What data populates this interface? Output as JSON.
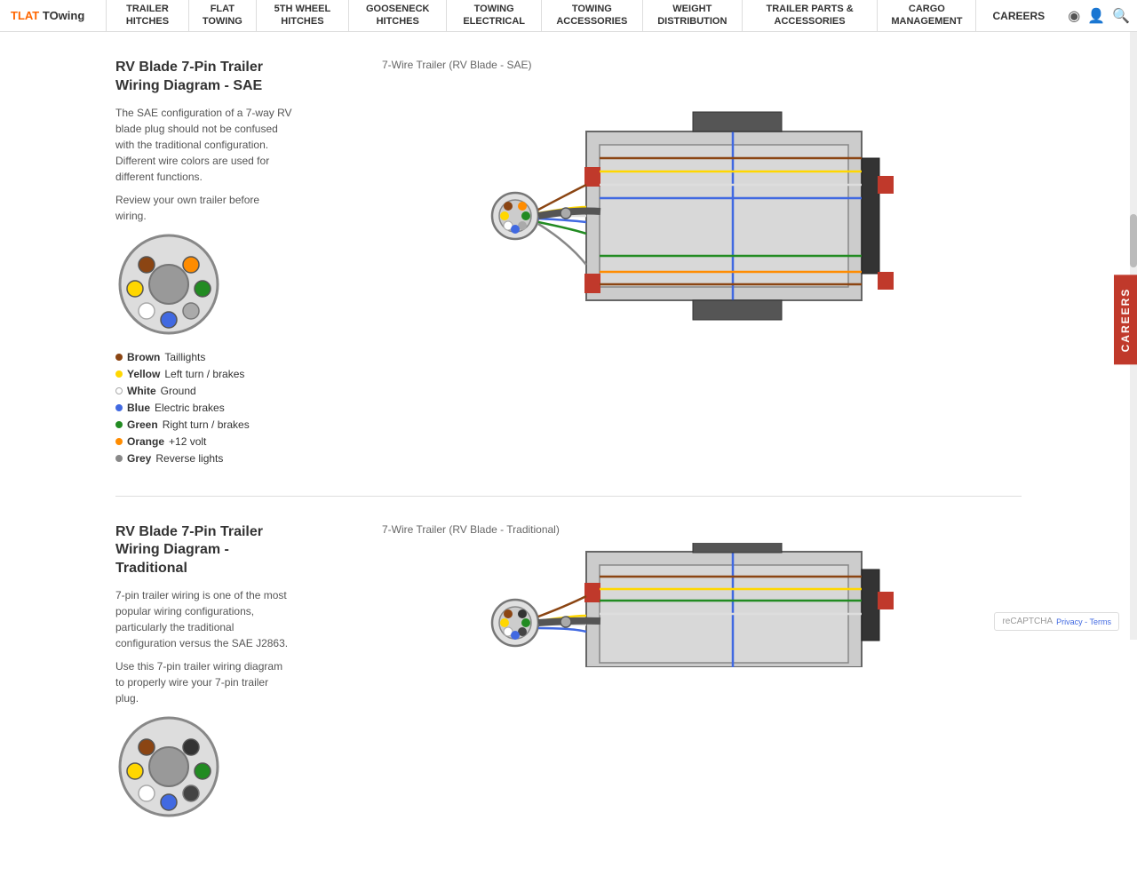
{
  "nav": {
    "logo_line1": "TLAT",
    "logo_line2": "TOwing",
    "items": [
      {
        "label": "TRAILER HITCHES"
      },
      {
        "label": "FLAT TOWING"
      },
      {
        "label": "5TH WHEEL HITCHES"
      },
      {
        "label": "GOOSENECK HITCHES"
      },
      {
        "label": "TOWING ELECTRICAL"
      },
      {
        "label": "TOWING ACCESSORIES"
      },
      {
        "label": "WEIGHT DISTRIBUTION"
      },
      {
        "label": "TRAILER PARTS & ACCESSORIES"
      },
      {
        "label": "CARGO MANAGEMENT"
      }
    ],
    "careers": "CAREERS"
  },
  "careers_tab": "CAREERS",
  "sections": [
    {
      "title": "RV Blade 7-Pin Trailer Wiring Diagram - SAE",
      "desc1": "The SAE configuration of a 7-way RV blade plug should not be confused with the traditional configuration. Different wire colors are used for different functions.",
      "desc2": "Review your own trailer before wiring.",
      "diagram_label": "7-Wire Trailer (RV Blade - SAE)",
      "wires": [
        {
          "color": "#8B4513",
          "name": "Brown",
          "func": "Taillights"
        },
        {
          "color": "#FFD700",
          "name": "Yellow",
          "func": "Left turn / brakes"
        },
        {
          "color": "#fff",
          "name": "White",
          "func": "Ground",
          "border": "#aaa"
        },
        {
          "color": "#4169E1",
          "name": "Blue",
          "func": "Electric brakes"
        },
        {
          "color": "#228B22",
          "name": "Green",
          "func": "Right turn / brakes"
        },
        {
          "color": "#FF8C00",
          "name": "Orange",
          "func": "+12 volt"
        },
        {
          "color": "#888",
          "name": "Grey",
          "func": "Reverse lights"
        }
      ]
    },
    {
      "title": "RV Blade 7-Pin Trailer Wiring Diagram - Traditional",
      "desc1": "7-pin trailer wiring is one of the most popular wiring configurations, particularly the traditional configuration versus the SAE J2863.",
      "desc2": "Use this 7-pin trailer wiring diagram to properly wire your 7-pin trailer plug.",
      "diagram_label": "7-Wire Trailer (RV Blade - Traditional)",
      "wires": []
    }
  ],
  "recaptcha": "reCAPTCHA"
}
